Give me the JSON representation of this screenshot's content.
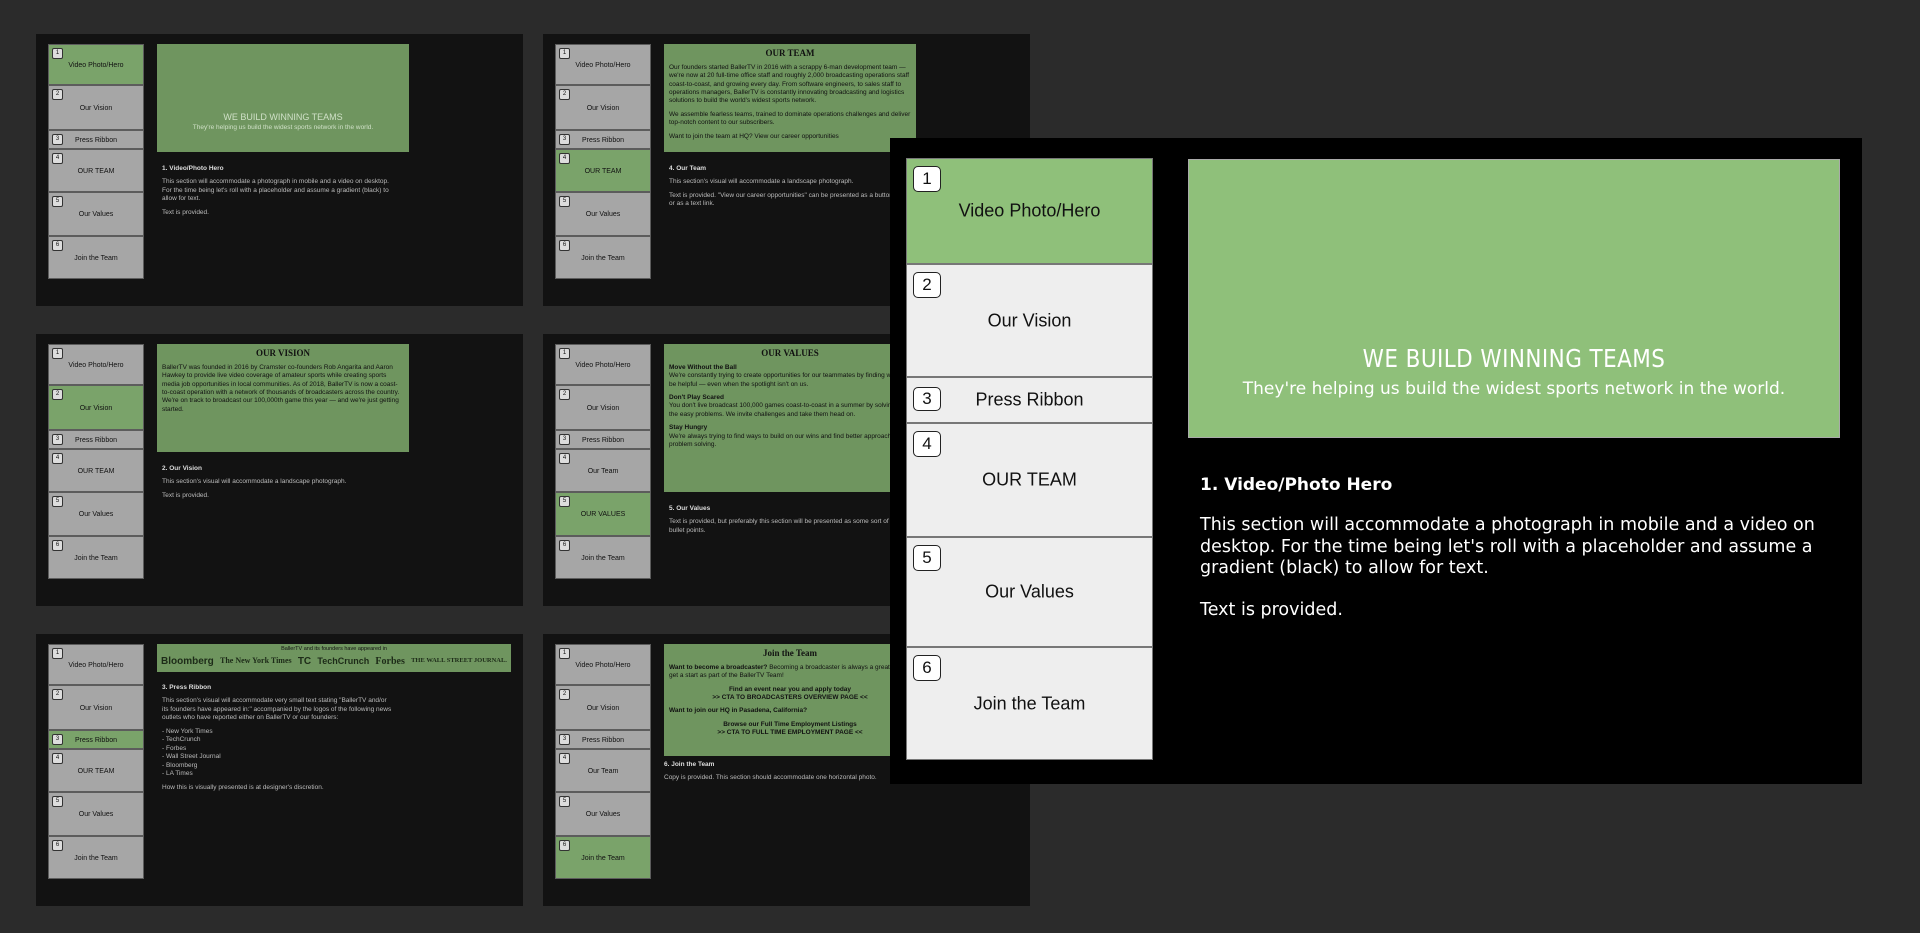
{
  "nav": [
    {
      "num": "1",
      "label": "Video Photo/Hero"
    },
    {
      "num": "2",
      "label": "Our Vision"
    },
    {
      "num": "3",
      "label": "Press Ribbon"
    },
    {
      "num": "4",
      "label": "OUR TEAM"
    },
    {
      "num": "5",
      "label": "Our Values"
    },
    {
      "num": "6",
      "label": "Join the Team"
    }
  ],
  "nav_variant": {
    "team": "Our Team",
    "values_active": "OUR VALUES"
  },
  "hero": {
    "title": "WE BUILD WINNING TEAMS",
    "subtitle": "They're helping us build the widest sports network in the world."
  },
  "big_desc": {
    "title": "1. Video/Photo Hero",
    "body": "This section will accommodate a photograph in mobile and a video on desktop. For the time being let's roll with a placeholder and assume a gradient (black) to allow for text.",
    "extra": "Text is provided."
  },
  "thumb_hero": {
    "title": "1. Video/Photo Hero",
    "body": "This section will accommodate a photograph in mobile and a video on desktop. For the time being let's roll with a placeholder and assume a gradient (black) to allow for text.",
    "extra": "Text is provided."
  },
  "thumb_team": {
    "card_title": "OUR TEAM",
    "p1": "Our founders started BallerTV in 2016 with a scrappy 6-man development team — we're now at 20 full-time office staff and roughly 2,000 broadcasting operations staff coast-to-coast, and growing every day. From software engineers, to sales staff to operations managers, BallerTV is constantly innovating broadcasting and logistics solutions to build the world's widest sports network.",
    "p2": "We assemble fearless teams, trained to dominate operations challenges and deliver top-notch content to our subscribers.",
    "p3": "Want to join the team at HQ? View our career opportunities",
    "title": "4. Our Team",
    "body": "This section's visual will accommodate a landscape photograph.",
    "extra": "Text is provided. \"View our career opportunities\" can be presented as a button or as a text link."
  },
  "thumb_vision": {
    "card_title": "OUR VISION",
    "p1": "BallerTV was founded in 2016 by Cramster co-founders Rob Angarita and Aaron Hawkey to provide live video coverage of amateur sports while creating sports media job opportunities in local communities. As of 2018, BallerTV is now a coast-to-coast operation with a network of thousands of broadcasters across the country. We're on track to broadcast our 100,000th game this year — and we're just getting started.",
    "title": "2. Our Vision",
    "body": "This section's visual will accommodate a landscape photograph.",
    "extra": "Text is provided."
  },
  "thumb_values": {
    "card_title": "OUR VALUES",
    "v1_title": "Move Without the Ball",
    "v1": "We're constantly trying to create opportunities for our teammates by finding ways to be helpful — even when the spotlight isn't on us.",
    "v2_title": "Don't Play Scared",
    "v2": "You don't live broadcast 100,000 games coast-to-coast in a summer by solving only the easy problems. We invite challenges and take them head on.",
    "v3_title": "Stay Hungry",
    "v3": "We're always trying to find ways to build on our wins and find better approaches to problem solving.",
    "title": "5. Our Values",
    "body": "Text is provided, but preferably this section will be presented as some sort of bullet points."
  },
  "thumb_press": {
    "caption": "BallerTV and its founders have appeared in",
    "logos": [
      "Bloomberg",
      "The New York Times",
      "TC",
      "TechCrunch",
      "Forbes",
      "THE WALL STREET JOURNAL."
    ],
    "title": "3. Press Ribbon",
    "body": "This section's visual will accommodate very small text stating \"BallerTV and/or its founders have appeared in:\" accompanied by the logos of the following news outlets who have reported either on BallerTV or our founders:",
    "list": [
      "- New York Times",
      "- TechCrunch",
      "- Forbes",
      "- Wall Street Journal",
      "- Bloomberg",
      "- LA Times"
    ],
    "extra": "How this is visually presented is at designer's discretion."
  },
  "thumb_join": {
    "card_title": "Join the Team",
    "q1_bold": "Want to become a broadcaster?",
    "q1": "Becoming a broadcaster is always a great way to get a start as part of the BallerTV Team!",
    "cta1a": "Find an event near you and apply today",
    "cta1b": ">> CTA TO BROADCASTERS OVERVIEW PAGE <<",
    "q2": "Want to join our HQ in Pasadena, California?",
    "cta2a": "Browse our Full Time Employment Listings",
    "cta2b": ">> CTA TO FULL TIME EMPLOYMENT PAGE <<",
    "title": "6. Join the Team",
    "body": "Copy is provided. This section should accommodate one horizontal photo."
  },
  "colors": {
    "background": "#2b2b2b",
    "board": "#121212",
    "accent_green": "#8fc07a",
    "thumb_green": "#6f955f"
  }
}
